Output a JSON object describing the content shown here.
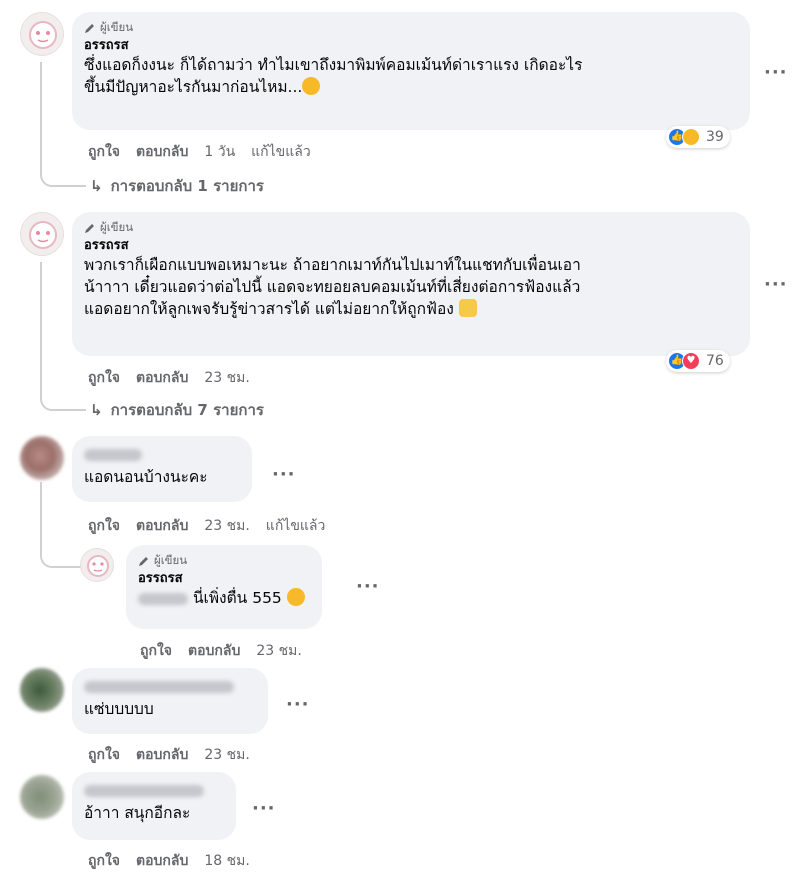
{
  "author_badge": "ผู้เขียน",
  "comments": [
    {
      "name": "อรรถรส",
      "lines": [
        "ซึ่งแอดก็งงนะ ก็ได้ถามว่า ทำไมเขาถึงมาพิมพ์คอมเม้นท์ด่าเราแรง เกิดอะไร",
        "ขึ้นมีปัญหาอะไรกันมาก่อนไหม..."
      ],
      "reaction_count": "39",
      "like": "ถูกใจ",
      "reply": "ตอบกลับ",
      "time": "1 วัน",
      "edited": "แก้ไขแล้ว",
      "replies_link": "การตอบกลับ 1 รายการ"
    },
    {
      "name": "อรรถรส",
      "lines": [
        "พวกเราก็เผือกแบบพอเหมาะนะ ถ้าอยากเมาท์กันไปเมาท์ในแชทกับเพื่อนเอา",
        "น้าาาา เดี๋ยวแอดว่าต่อไปนี้ แอดจะทยอยลบคอมเม้นท์ที่เสี่ยงต่อการฟ้องแล้ว",
        "แอดอยากให้ลูกเพจรับรู้ข่าวสารได้ แต่ไม่อยากให้ถูกฟ้อง"
      ],
      "reaction_count": "76",
      "like": "ถูกใจ",
      "reply": "ตอบกลับ",
      "time": "23 ชม.",
      "replies_link": "การตอบกลับ 7 รายการ"
    },
    {
      "text": "แอดนอนบ้างนะคะ",
      "like": "ถูกใจ",
      "reply": "ตอบกลับ",
      "time": "23 ชม.",
      "edited": "แก้ไขแล้ว"
    },
    {
      "name": "อรรถรส",
      "text": "นี่เพิ่งตื่น 555",
      "like": "ถูกใจ",
      "reply": "ตอบกลับ",
      "time": "23 ชม."
    },
    {
      "text": "แซ่บบบบบ",
      "like": "ถูกใจ",
      "reply": "ตอบกลับ",
      "time": "23 ชม."
    },
    {
      "text": "อ้าาา สนุกอีกละ",
      "like": "ถูกใจ",
      "reply": "ตอบกลับ",
      "time": "18 ชม."
    }
  ],
  "icons": {
    "more": "more-options-icon",
    "reply_arrow": "reply-arrow-icon",
    "pencil": "pencil-icon"
  }
}
